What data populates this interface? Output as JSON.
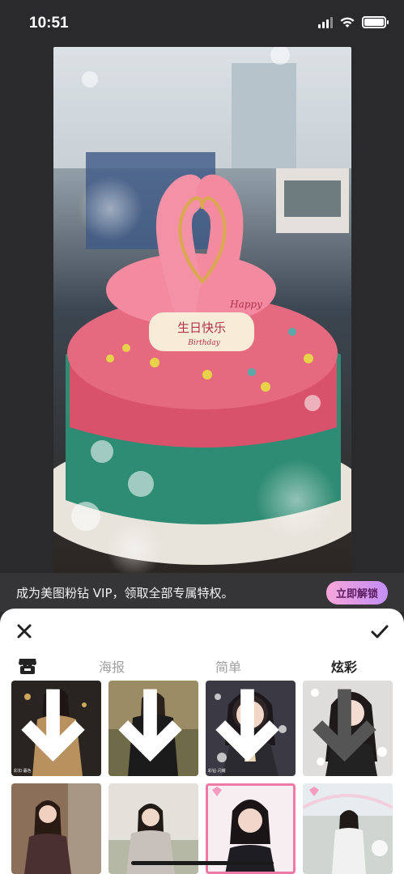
{
  "status_bar": {
    "time": "10:51"
  },
  "photo": {
    "cake_text": "生日快乐",
    "cake_text2": "Happy",
    "cake_text3": "Birthday"
  },
  "vip_banner": {
    "text": "成为美图粉钻 VIP，领取全部专属特权。",
    "button": "立即解锁"
  },
  "tabs": [
    {
      "label": "海报",
      "active": false
    },
    {
      "label": "简单",
      "active": false
    },
    {
      "label": "炫彩",
      "active": true
    }
  ],
  "thumbnails": [
    {
      "caption": "彩扣·暮色"
    },
    {
      "caption": ""
    },
    {
      "caption": "彩钻·闪耀"
    },
    {
      "caption": ""
    },
    {
      "caption": ""
    },
    {
      "caption": ""
    },
    {
      "caption": ""
    },
    {
      "caption": ""
    }
  ],
  "colors": {
    "vip_gradient_start": "#f7a6d9",
    "vip_gradient_end": "#c38ef5",
    "selected_border": "#f07aa6"
  }
}
